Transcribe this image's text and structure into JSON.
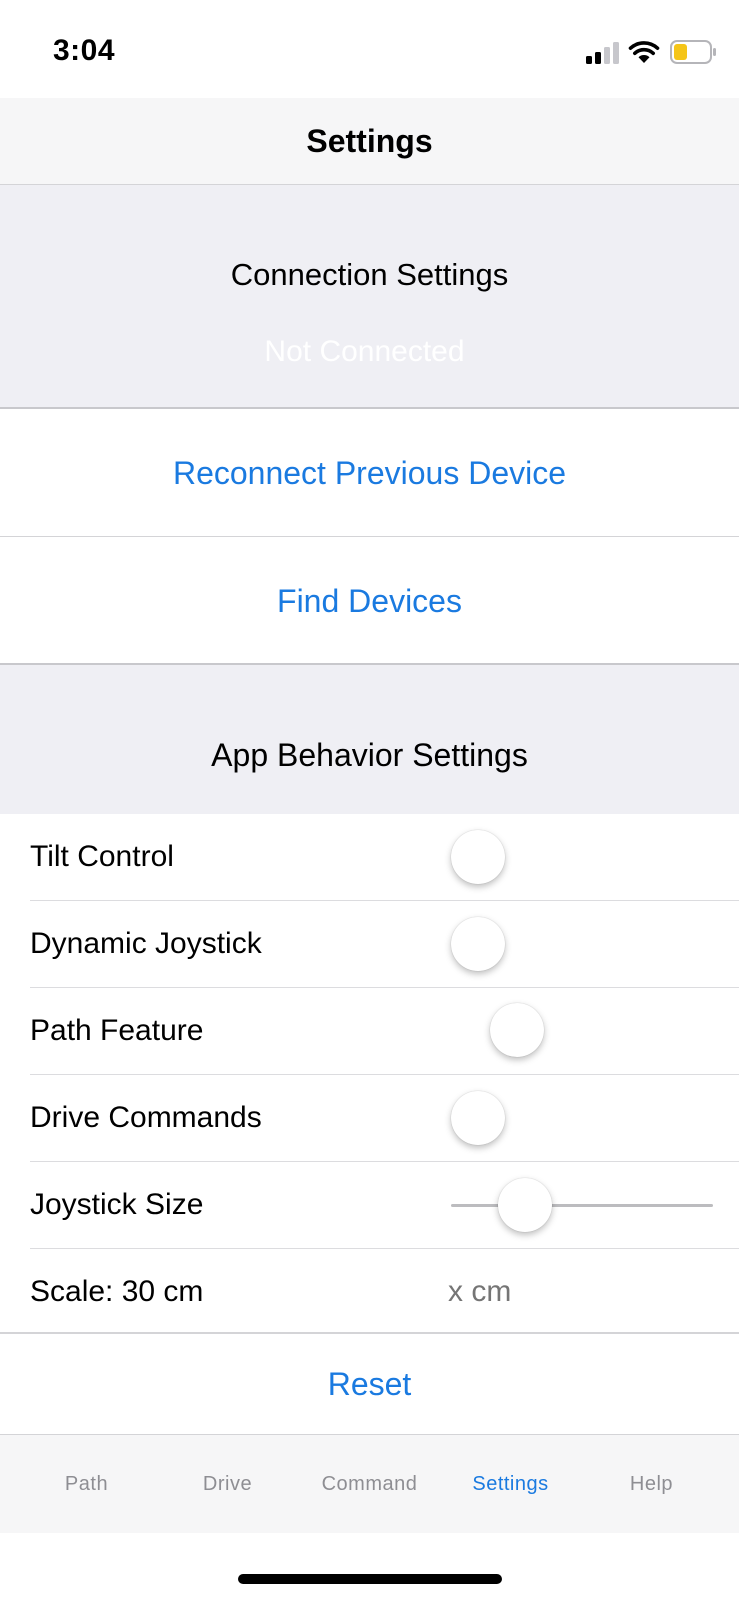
{
  "status_bar": {
    "time": "3:04",
    "battery_color": "#f5c518"
  },
  "nav": {
    "title": "Settings"
  },
  "connection": {
    "title": "Connection Settings",
    "status": "Not Connected",
    "reconnect_label": "Reconnect Previous Device",
    "find_label": "Find Devices"
  },
  "behavior": {
    "title": "App Behavior Settings",
    "rows": [
      {
        "label": "Tilt Control"
      },
      {
        "label": "Dynamic Joystick"
      },
      {
        "label": "Path Feature"
      },
      {
        "label": "Drive Commands"
      },
      {
        "label": "Joystick Size"
      },
      {
        "label": "Scale: 30 cm"
      }
    ],
    "scale_placeholder": "x cm",
    "reset_label": "Reset"
  },
  "tab_bar": {
    "tabs": [
      {
        "label": "Path"
      },
      {
        "label": "Drive"
      },
      {
        "label": "Command"
      },
      {
        "label": "Settings"
      },
      {
        "label": "Help"
      }
    ],
    "active": "Settings"
  },
  "colors": {
    "accent": "#1a7ae0",
    "header_bg": "#efeff4"
  }
}
